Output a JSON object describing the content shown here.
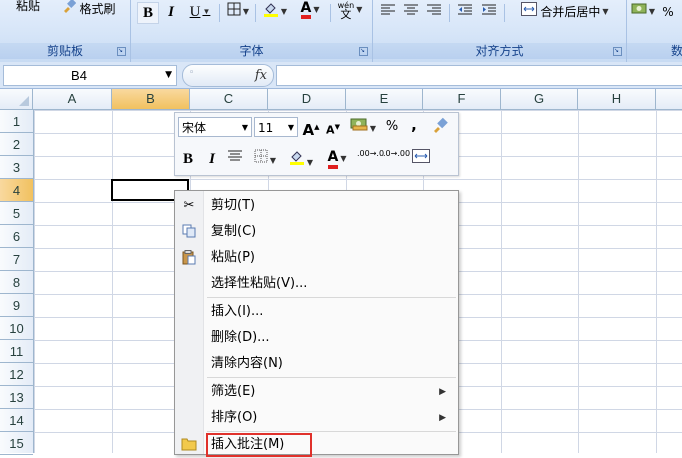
{
  "ribbon": {
    "clipboard": {
      "paste_label": "粘贴",
      "format_painter_label": "格式刷",
      "group_label": "剪贴板"
    },
    "font": {
      "bold": "B",
      "italic": "I",
      "underline": "U",
      "font_color_letter": "A",
      "phonetic": "wén",
      "group_label": "字体"
    },
    "alignment": {
      "merge_center_label": "合并后居中",
      "group_label": "对齐方式"
    },
    "number": {
      "group_label": "数",
      "percent": "%"
    }
  },
  "formula_bar": {
    "name_box": "B4",
    "fx": "fx",
    "value": ""
  },
  "columns": [
    "A",
    "B",
    "C",
    "D",
    "E",
    "F",
    "G",
    "H"
  ],
  "rows": [
    "1",
    "2",
    "3",
    "4",
    "5",
    "6",
    "7",
    "8",
    "9",
    "10",
    "11",
    "12",
    "13",
    "14",
    "15"
  ],
  "selection": {
    "column": "B",
    "row": "4"
  },
  "mini_toolbar": {
    "font_name": "宋体",
    "font_size": "11",
    "grow_font": "A",
    "shrink_font": "A",
    "percent": "%",
    "comma": ",",
    "bold": "B",
    "italic": "I",
    "font_color_letter": "A",
    "increase_decimal": ".00→.0",
    "decrease_decimal": ".0→.00"
  },
  "context_menu": {
    "items": [
      {
        "label": "剪切(T)"
      },
      {
        "label": "复制(C)"
      },
      {
        "label": "粘贴(P)"
      },
      {
        "label": "选择性粘贴(V)..."
      },
      {
        "label": "插入(I)..."
      },
      {
        "label": "删除(D)..."
      },
      {
        "label": "清除内容(N)"
      },
      {
        "label": "筛选(E)"
      },
      {
        "label": "排序(O)"
      },
      {
        "label": "插入批注(M)"
      }
    ]
  },
  "colors": {
    "highlight_box": "#e0312b",
    "selected_header": "#f1c15f",
    "ribbon_label": "#15428b"
  }
}
